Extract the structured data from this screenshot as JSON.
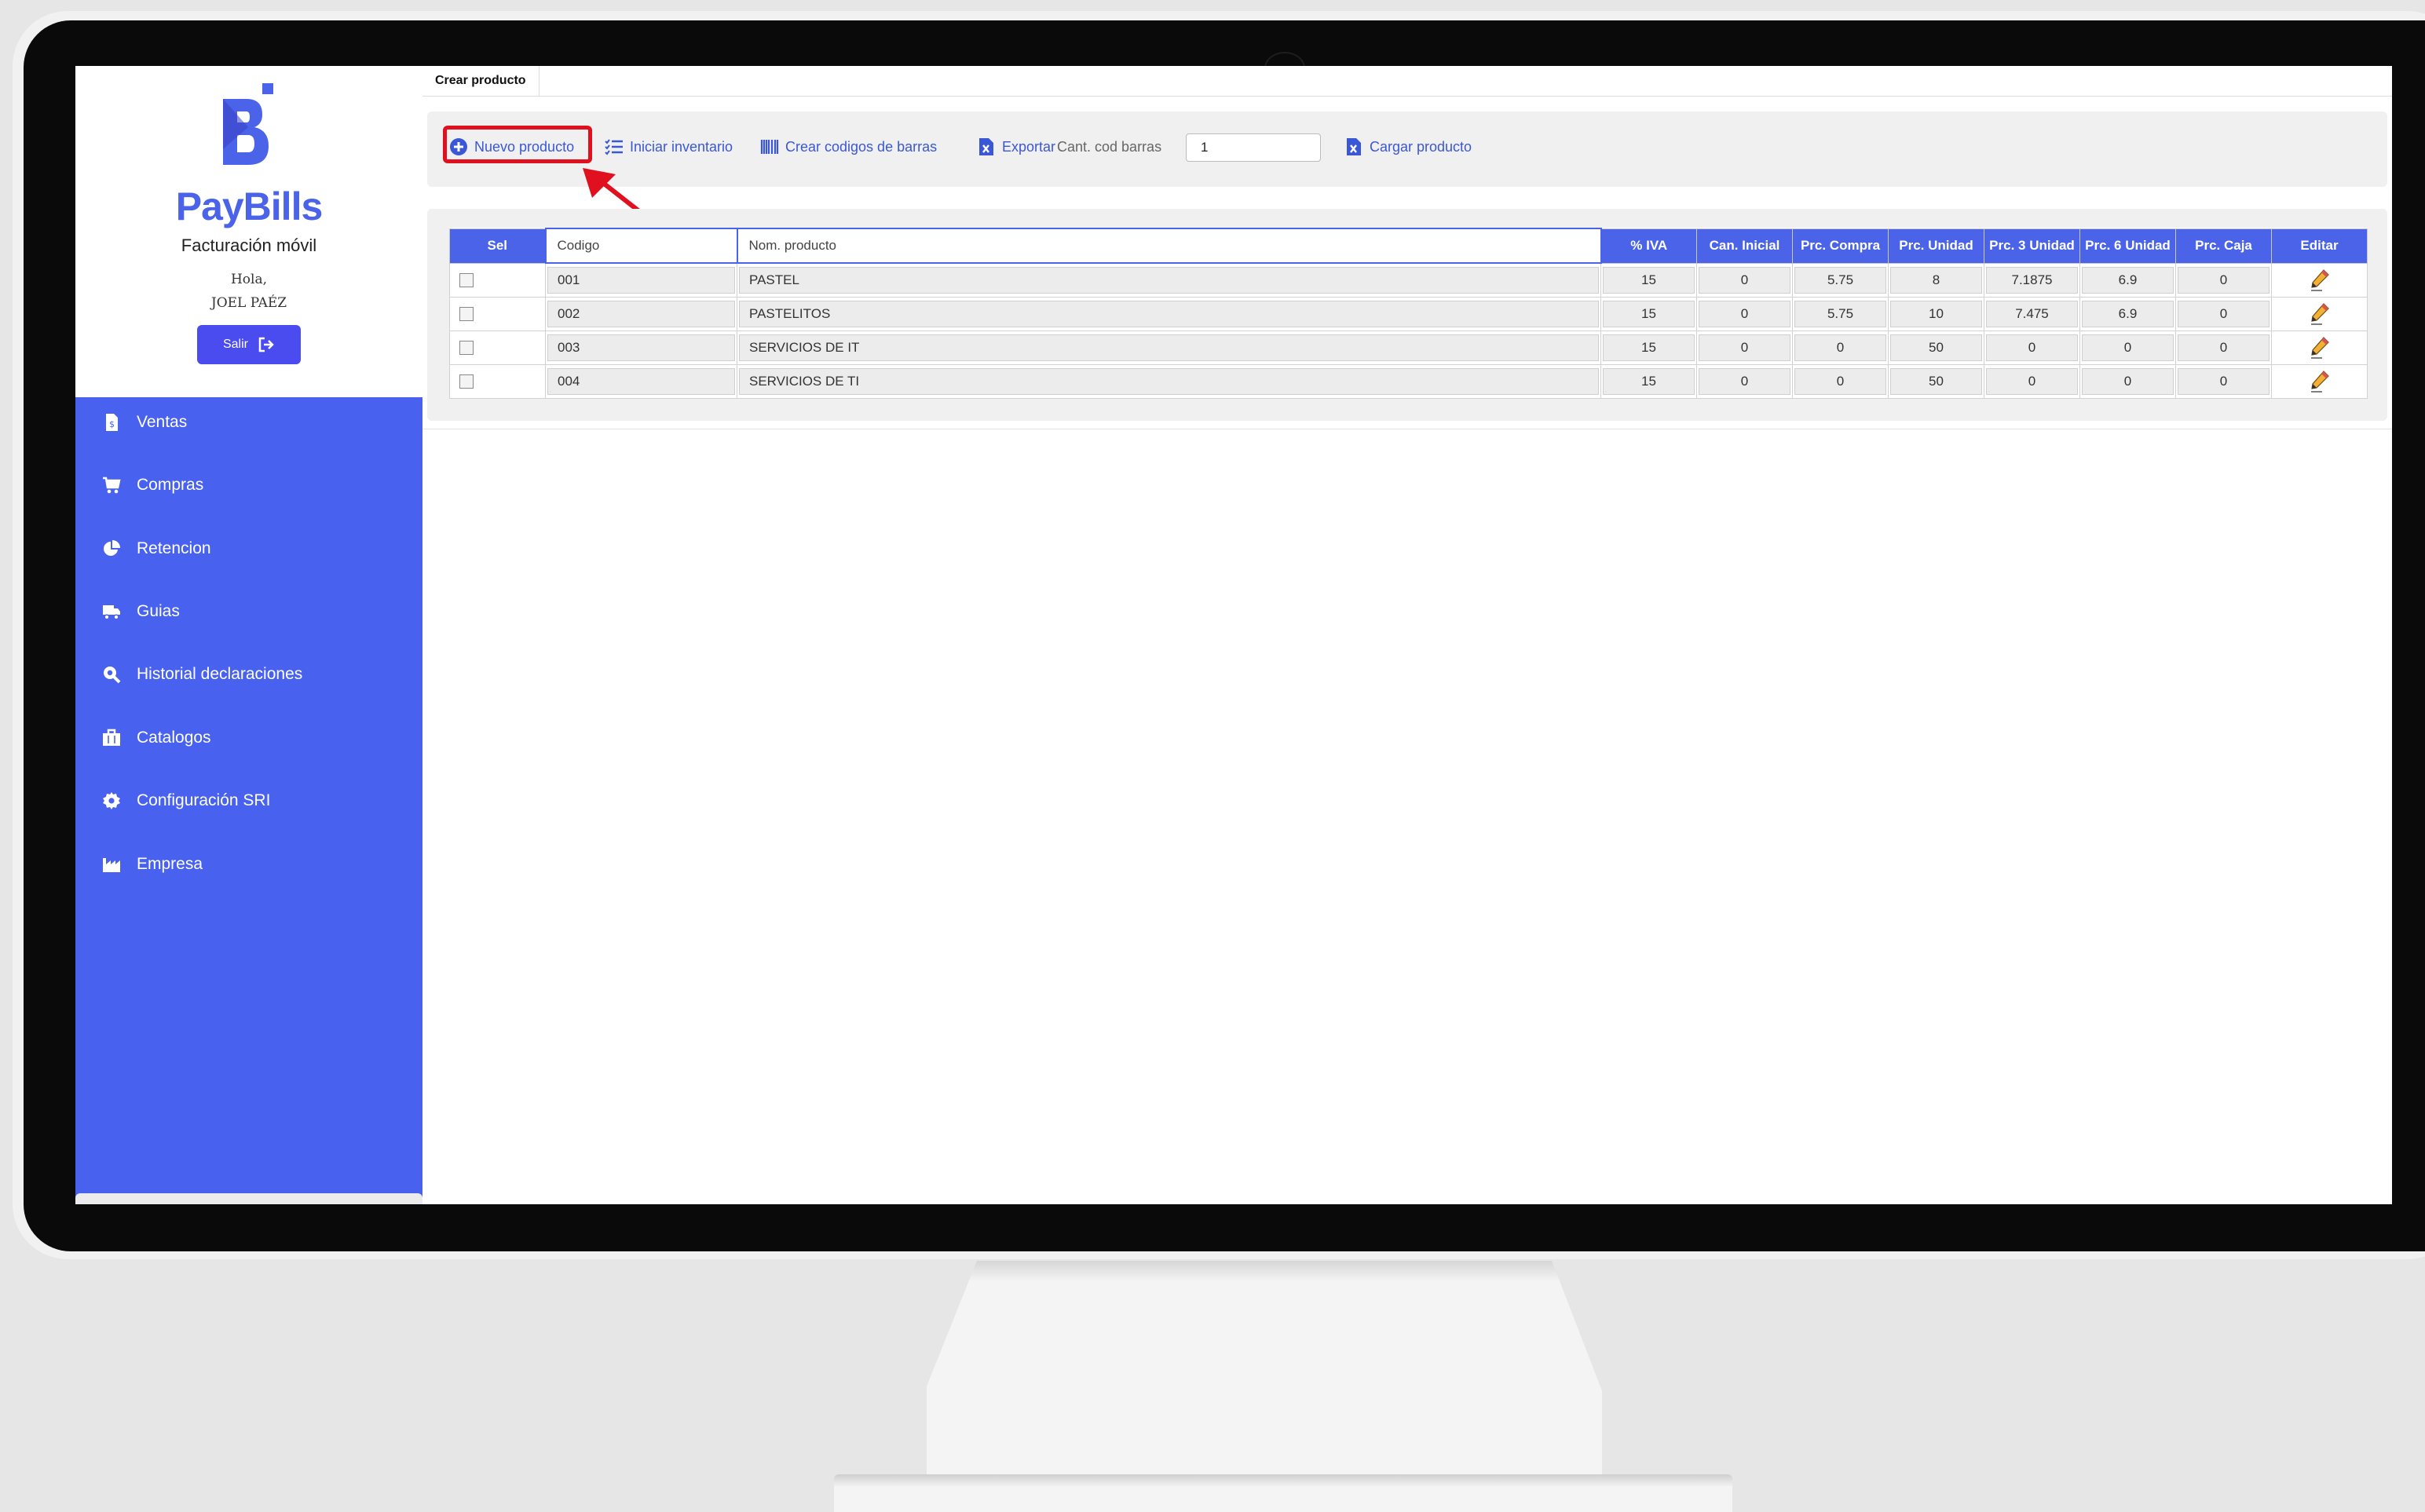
{
  "brand": {
    "name": "PayBills",
    "tagline": "Facturación móvil",
    "accent": "#4a63e8"
  },
  "user": {
    "greeting": "Hola,",
    "name": "JOEL PAÉZ",
    "logout_label": "Salir"
  },
  "sidebar": {
    "color": "#4862ef",
    "items": [
      {
        "label": "Ventas",
        "icon": "receipt-icon"
      },
      {
        "label": "Compras",
        "icon": "cart-icon"
      },
      {
        "label": "Retencion",
        "icon": "pie-chart-icon"
      },
      {
        "label": "Guias",
        "icon": "truck-icon"
      },
      {
        "label": "Historial declaraciones",
        "icon": "search-doc-icon"
      },
      {
        "label": "Catalogos",
        "icon": "briefcase-icon"
      },
      {
        "label": "Configuración SRI",
        "icon": "gear-icon"
      },
      {
        "label": "Empresa",
        "icon": "factory-icon"
      }
    ]
  },
  "tabs": [
    {
      "label": "Crear producto"
    }
  ],
  "toolbar": {
    "new_product": "Nuevo producto",
    "start_inventory": "Iniciar inventario",
    "barcodes": "Crear codigos de barras",
    "export": "Exportar",
    "barcode_qty_label": "Cant. cod barras",
    "barcode_qty_value": "1",
    "load_product": "Cargar producto"
  },
  "table": {
    "headers": {
      "sel": "Sel",
      "codigo": "Codigo",
      "nombre": "Nom. producto",
      "iva": "% IVA",
      "can_inicial": "Can. Inicial",
      "prc_compra": "Prc. Compra",
      "prc_unidad": "Prc. Unidad",
      "prc3": "Prc. 3 Unidad",
      "prc6": "Prc. 6 Unidad",
      "prc_caja": "Prc. Caja",
      "editar": "Editar"
    },
    "rows": [
      {
        "codigo": "001",
        "nombre": "PASTEL",
        "iva": "15",
        "can_inicial": "0",
        "prc_compra": "5.75",
        "prc_unidad": "8",
        "prc3": "7.1875",
        "prc6": "6.9",
        "prc_caja": "0"
      },
      {
        "codigo": "002",
        "nombre": "PASTELITOS",
        "iva": "15",
        "can_inicial": "0",
        "prc_compra": "5.75",
        "prc_unidad": "10",
        "prc3": "7.475",
        "prc6": "6.9",
        "prc_caja": "0"
      },
      {
        "codigo": "003",
        "nombre": "SERVICIOS DE IT",
        "iva": "15",
        "can_inicial": "0",
        "prc_compra": "0",
        "prc_unidad": "50",
        "prc3": "0",
        "prc6": "0",
        "prc_caja": "0"
      },
      {
        "codigo": "004",
        "nombre": "SERVICIOS DE TI",
        "iva": "15",
        "can_inicial": "0",
        "prc_compra": "0",
        "prc_unidad": "50",
        "prc3": "0",
        "prc6": "0",
        "prc_caja": "0"
      }
    ]
  },
  "annotation": {
    "color": "#e0101e"
  }
}
